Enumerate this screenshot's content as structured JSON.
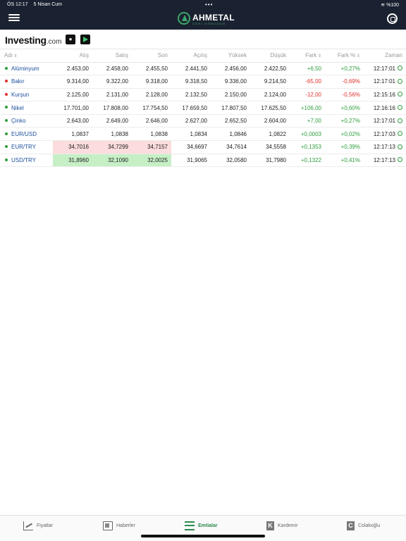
{
  "status": {
    "time": "ÖS 12:17",
    "date": "5 Nisan Cum",
    "dots": "•••",
    "battery": "%100"
  },
  "header": {
    "logo_name": "AHMETAL",
    "logo_sub": "GERİ DÖNÜŞÜM"
  },
  "brand": {
    "investing": "Investing",
    "dotcom": ".com"
  },
  "columns": [
    "Adı",
    "Alış",
    "Satış",
    "Son",
    "Açılış",
    "Yüksek",
    "Düşük",
    "Fark",
    "Fark %",
    "Zaman"
  ],
  "rows": [
    {
      "name": "Alüminyum",
      "alis": "2.453,00",
      "satis": "2.458,00",
      "son": "2.455,50",
      "acilis": "2.441,50",
      "yuksek": "2.456,00",
      "dusuk": "2.422,50",
      "fark": "+6,50",
      "fark_pct": "+0,27%",
      "zaman": "12:17:01",
      "dir": "up",
      "hl": ""
    },
    {
      "name": "Bakır",
      "alis": "9.314,00",
      "satis": "9.322,00",
      "son": "9.318,00",
      "acilis": "9.318,50",
      "yuksek": "9.336,00",
      "dusuk": "9.214,50",
      "fark": "-65,00",
      "fark_pct": "-0,69%",
      "zaman": "12:17:01",
      "dir": "down",
      "hl": ""
    },
    {
      "name": "Kurşun",
      "alis": "2.125,00",
      "satis": "2.131,00",
      "son": "2.128,00",
      "acilis": "2.132,50",
      "yuksek": "2.150,00",
      "dusuk": "2.124,00",
      "fark": "-12,00",
      "fark_pct": "-0,56%",
      "zaman": "12:15:16",
      "dir": "down",
      "hl": ""
    },
    {
      "name": "Nikel",
      "alis": "17.701,00",
      "satis": "17.808,00",
      "son": "17.754,50",
      "acilis": "17.659,50",
      "yuksek": "17.807,50",
      "dusuk": "17.625,50",
      "fark": "+106,00",
      "fark_pct": "+0,60%",
      "zaman": "12:16:16",
      "dir": "up",
      "hl": ""
    },
    {
      "name": "Çinko",
      "alis": "2.643,00",
      "satis": "2.649,00",
      "son": "2.646,00",
      "acilis": "2.627,00",
      "yuksek": "2.652,50",
      "dusuk": "2.604,00",
      "fark": "+7,00",
      "fark_pct": "+0,27%",
      "zaman": "12:17:01",
      "dir": "up",
      "hl": ""
    },
    {
      "name": "EUR/USD",
      "alis": "1,0837",
      "satis": "1,0838",
      "son": "1,0838",
      "acilis": "1,0834",
      "yuksek": "1,0846",
      "dusuk": "1,0822",
      "fark": "+0,0003",
      "fark_pct": "+0,02%",
      "zaman": "12:17:03",
      "dir": "up",
      "hl": ""
    },
    {
      "name": "EUR/TRY",
      "alis": "34,7016",
      "satis": "34,7299",
      "son": "34,7157",
      "acilis": "34,6697",
      "yuksek": "34,7614",
      "dusuk": "34,5558",
      "fark": "+0,1353",
      "fark_pct": "+0,39%",
      "zaman": "12:17:13",
      "dir": "up",
      "hl": "red"
    },
    {
      "name": "USD/TRY",
      "alis": "31,8960",
      "satis": "32,1090",
      "son": "32,0025",
      "acilis": "31,9065",
      "yuksek": "32,0580",
      "dusuk": "31,7980",
      "fark": "+0,1322",
      "fark_pct": "+0,41%",
      "zaman": "12:17:13",
      "dir": "up",
      "hl": "green"
    }
  ],
  "colors": {
    "up": "#2e9e3c",
    "down": "#e0302b",
    "header_bg": "#1a2130",
    "accent": "#2d8a4e",
    "hl_red": "#fcdcdc",
    "hl_green": "#c6efc6"
  },
  "tabs": [
    {
      "label": "Fiyatlar",
      "icon": "chart-icon",
      "active": false
    },
    {
      "label": "Haberler",
      "icon": "news-icon",
      "active": false
    },
    {
      "label": "Emtialar",
      "icon": "list-icon",
      "active": true
    },
    {
      "label": "Kardemir",
      "icon": "k-letter-icon",
      "letter": "K",
      "active": false
    },
    {
      "label": "Colakoğlu",
      "icon": "c-letter-icon",
      "letter": "C",
      "active": false
    }
  ]
}
